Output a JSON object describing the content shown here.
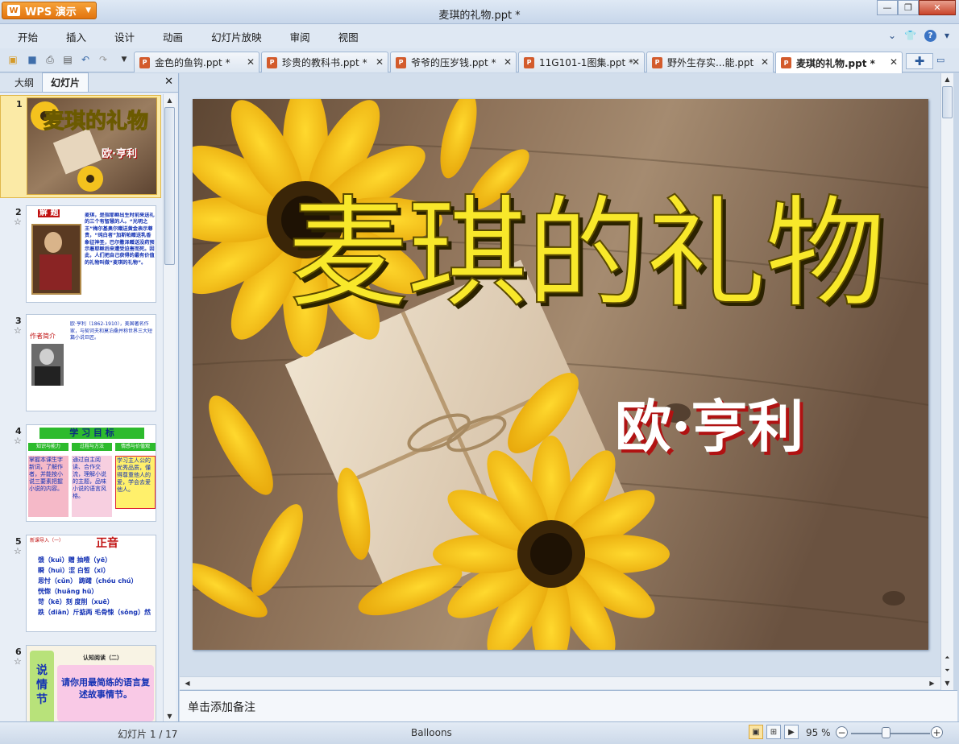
{
  "window": {
    "app_button": "WPS 演示",
    "title": "麦琪的礼物.ppt *"
  },
  "menu": {
    "items": [
      "开始",
      "插入",
      "设计",
      "动画",
      "幻灯片放映",
      "审阅",
      "视图"
    ]
  },
  "doc_tabs": [
    {
      "label": "金色的鱼钩.ppt *",
      "active": false
    },
    {
      "label": "珍贵的教科书.ppt *",
      "active": false
    },
    {
      "label": "爷爷的压岁钱.ppt *",
      "active": false
    },
    {
      "label": "11G101-1图集.ppt *",
      "active": false
    },
    {
      "label": "野外生存实...能.ppt",
      "active": false
    },
    {
      "label": "麦琪的礼物.ppt *",
      "active": true
    }
  ],
  "left_panel": {
    "tabs": [
      "大纲",
      "幻灯片"
    ],
    "active_tab": "幻灯片",
    "thumbnails": [
      {
        "number": "1",
        "title": "麦琪的礼物",
        "author": "欧·亨利"
      },
      {
        "number": "2",
        "star": "☆",
        "heading": "解 题",
        "body": "麦琪，是指耶稣出生时前来送礼的三个有智慧的人。“光明之王”梅尔基奥尔赠送黄金表示尊贵，“纯白者”加斯帕赠送乳香象征神圣，巴尔撒泽赠送没药预示着耶稣后来遭受迫害而死。因此，人们把自己获得的最有价值的礼物叫做“麦琪的礼物”。"
      },
      {
        "number": "3",
        "star": "☆",
        "heading": "作者简介",
        "body": "欧·亨利（1862-1910），美国著名作家，与契诃夫和莫泊桑并称世界三大短篇小说巨匠。"
      },
      {
        "number": "4",
        "star": "☆",
        "heading": "学 习 目 标",
        "cols": [
          "知识与能力",
          "过程与方法",
          "情感与价值观"
        ],
        "boxes": [
          "掌握本课生字新词，了解作者，并能按小说三要素把握小说的内容。",
          "通过自主阅读、合作交流，理解小说的主题，品味小说的语言风格。",
          "学习主人公的优秀品质，懂得尊重他人的爱，学会去爱他人。"
        ]
      },
      {
        "number": "5",
        "star": "☆",
        "heading": "正音",
        "tag": "新课导入（一）",
        "lines": [
          "馈（kuì）赠  抽噎（yē）",
          "瞬（huì）涩  白晳（xī）",
          "思忖（cǔn）  踌躇（chóu chú）",
          "恍惚（huǎng  hū）",
          "苛（kē）刻  度削（xuē）",
          "跌（diān）斤掂两  毛骨悚（sǒng）然"
        ]
      },
      {
        "number": "6",
        "star": "☆",
        "tag": "认知阅读（二）",
        "side": "说情节",
        "body": "请你用最简练的语言复述故事情节。"
      }
    ]
  },
  "slide": {
    "title": "麦琪的礼物",
    "author": "欧·亨利"
  },
  "notes_placeholder": "单击添加备注",
  "status": {
    "slide_counter": "幻灯片 1 / 17",
    "theme": "Balloons",
    "zoom": "95 %",
    "zoom_level": 0.5
  }
}
